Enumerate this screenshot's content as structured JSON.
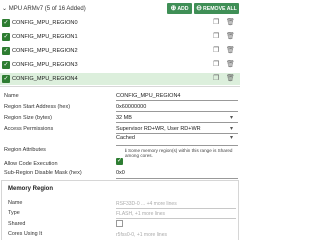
{
  "header": {
    "title": "MPU ARMv7 (5 of 16 Added)",
    "add_label": "ADD",
    "remove_all_label": "REMOVE ALL",
    "collapse_glyph": "⌄",
    "add_glyph": "⊕",
    "remove_glyph": "⊖"
  },
  "regions": [
    {
      "name": "CONFIG_MPU_REGION0",
      "checked": true,
      "selected": false
    },
    {
      "name": "CONFIG_MPU_REGION1",
      "checked": true,
      "selected": false
    },
    {
      "name": "CONFIG_MPU_REGION2",
      "checked": true,
      "selected": false
    },
    {
      "name": "CONFIG_MPU_REGION3",
      "checked": true,
      "selected": false
    },
    {
      "name": "CONFIG_MPU_REGION4",
      "checked": true,
      "selected": true
    }
  ],
  "icons": {
    "check": "✓",
    "copy": "❐",
    "delete": "🗑",
    "caret": "▾",
    "info": "ℹ"
  },
  "form": {
    "name_label": "Name",
    "name_value": "CONFIG_MPU_REGION4",
    "start_label": "Region Start Address (hex)",
    "start_value": "0x60000000",
    "size_label": "Region Size (bytes)",
    "size_value": "32 MB",
    "access_label": "Access Permissions",
    "access_value": "Supervisor RD+WR, User RD+WR",
    "attributes_label": "Region Attributes",
    "attributes_value": "Cached",
    "attributes_note": "Some memory region(s) within this range is Shared among cores.",
    "exec_label": "Allow Code Execution",
    "exec_checked": true,
    "subregion_label": "Sub-Region Disable Mask (hex)",
    "subregion_value": "0x0"
  },
  "memory_region": {
    "title": "Memory Region",
    "name_label": "Name",
    "name_value": "RSF33D-0 ... +4 more lines",
    "type_label": "Type",
    "type_value": "FLASH, +1 more lines",
    "shared_label": "Shared",
    "cores_label": "Cores Using It",
    "cores_value": "r5fss0-0, +1 more lines"
  },
  "colors": {
    "accent": "#3f8f56",
    "selected_row": "#dcefdc"
  }
}
